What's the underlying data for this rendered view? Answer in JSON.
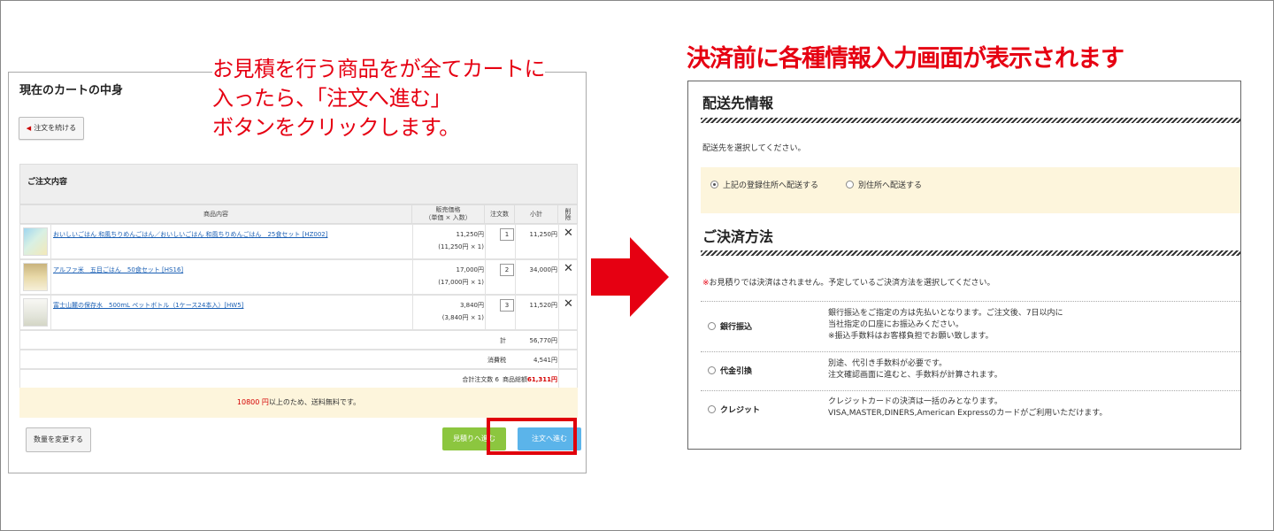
{
  "left_callout": [
    "お見積を行う商品をが全てカートに",
    "入ったら、「注文へ進む」",
    "ボタンをクリックします。"
  ],
  "right_callout": "決済前に各種情報入力画面が表示されます",
  "cart": {
    "title": "現在のカートの中身",
    "continue_label": "注文を続ける",
    "order_heading": "ご注文内容",
    "columns": {
      "product": "商品内容",
      "price_line1": "販売価格",
      "price_line2": "（単価 × 入数）",
      "qty": "注文数",
      "subtotal": "小計",
      "delete": "削除"
    },
    "rows": [
      {
        "name": "おいしいごはん 和風ちりめんごはん／おいしいごはん 和風ちりめんごはん　25食セット [HZ002]",
        "price": "11,250円",
        "detail": "(11,250円 × 1)",
        "qty": "1",
        "subtotal": "11,250円"
      },
      {
        "name": "アルファ米　五目ごはん　50食セット [HS16]",
        "price": "17,000円",
        "detail": "(17,000円 × 1)",
        "qty": "2",
        "subtotal": "34,000円"
      },
      {
        "name": "富士山麓の保存水　500mL ペットボトル（1ケース24本入）[HW5]",
        "price": "3,840円",
        "detail": "(3,840円 × 1)",
        "qty": "3",
        "subtotal": "11,520円"
      }
    ],
    "total_label": "計",
    "total_value": "56,770円",
    "tax_label": "消費税",
    "tax_value": "4,541円",
    "count_label": "合計注文数 6",
    "grand_label": "商品総額",
    "grand_value": "61,311円",
    "free_amount": "10800 円",
    "free_text": "以上のため、送料無料です。",
    "change_qty_label": "数量を変更する",
    "estimate_label": "見積りへ進む",
    "order_label": "注文へ進む"
  },
  "checkout": {
    "shipping_title": "配送先情報",
    "shipping_prompt": "配送先を選択してください。",
    "ship_option1": "上記の登録住所へ配送する",
    "ship_option2": "別住所へ配送する",
    "payment_title": "ご決済方法",
    "payment_mark": "※",
    "payment_note": "お見積りでは決済はされません。予定しているご決済方法を選択してください。",
    "methods": [
      {
        "label": "銀行振込",
        "desc": [
          "銀行振込をご指定の方は先払いとなります。ご注文後、7日以内に",
          "当社指定の口座にお振込みください。",
          "※振込手数料はお客様負担でお願い致します。"
        ]
      },
      {
        "label": "代金引換",
        "desc": [
          "別途、代引き手数料が必要です。",
          "注文確認画面に進むと、手数料が計算されます。"
        ]
      },
      {
        "label": "クレジット",
        "desc": [
          "クレジットカードの決済は一括のみとなります。",
          "VISA,MASTER,DINERS,American Expressのカードがご利用いただけます。"
        ]
      }
    ]
  },
  "colors": {
    "callout": "#e60012",
    "arrow": "#e60012",
    "highlight": "#e0000c",
    "estimate_button": "#8cc63f",
    "order_button": "#5bb4ea",
    "notice_bg": "#fdf5dc"
  }
}
